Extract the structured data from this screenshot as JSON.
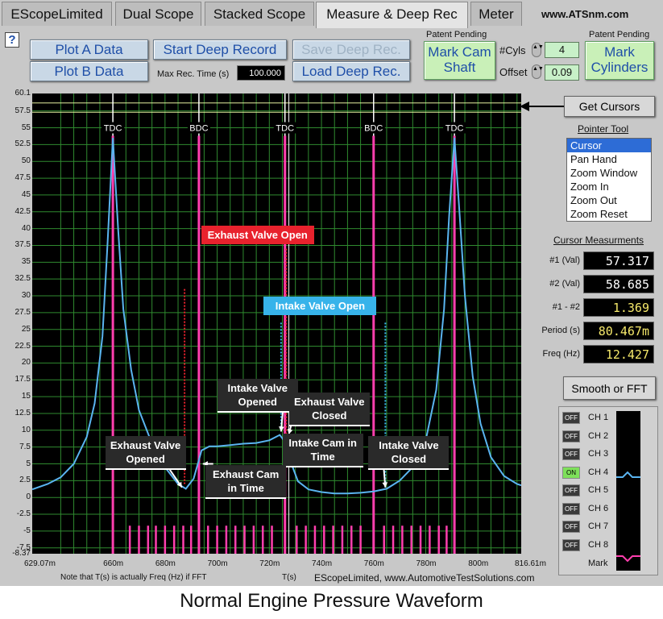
{
  "tabs": [
    {
      "label": "EScopeLimited",
      "active": false
    },
    {
      "label": "Dual Scope",
      "active": false
    },
    {
      "label": "Stacked Scope",
      "active": false
    },
    {
      "label": "Measure & Deep Rec",
      "active": true
    },
    {
      "label": "Meter",
      "active": false
    }
  ],
  "site": "www.ATSnm.com",
  "help": "?",
  "buttons": {
    "plot_a": "Plot A Data",
    "plot_b": "Plot B Data",
    "start_deep": "Start Deep Record",
    "save_deep": "Save Deep Rec.",
    "load_deep": "Load Deep Rec.",
    "mark_cam": "Mark Cam Shaft",
    "mark_cyl": "Mark Cylinders",
    "get_cursors": "Get Cursors",
    "smooth_fft": "Smooth or FFT"
  },
  "patent1": "Patent Pending",
  "patent2": "Patent Pending",
  "max_rec_label": "Max Rec. Time (s)",
  "max_rec_value": "100.000",
  "cyls_label": "#Cyls",
  "cyls_value": "4",
  "offset_label": "Offset",
  "offset_value": "0.09",
  "pointer": {
    "title": "Pointer Tool",
    "items": [
      "Cursor",
      "Pan Hand",
      "Zoom Window",
      "Zoom In",
      "Zoom Out",
      "Zoom Reset"
    ],
    "selected": 0
  },
  "cursor": {
    "title": "Cursor Measurments",
    "rows": [
      {
        "label": "#1 (Val)",
        "value": "57.317",
        "yellow": false
      },
      {
        "label": "#2 (Val)",
        "value": "58.685",
        "yellow": false
      },
      {
        "label": "#1 - #2",
        "value": "1.369",
        "yellow": true
      },
      {
        "label": "Period (s)",
        "value": "80.467m",
        "yellow": true
      },
      {
        "label": "Freq (Hz)",
        "value": "12.427",
        "yellow": true
      }
    ]
  },
  "channels": [
    {
      "label": "CH 1",
      "state": "OFF"
    },
    {
      "label": "CH 2",
      "state": "OFF"
    },
    {
      "label": "CH 3",
      "state": "OFF"
    },
    {
      "label": "CH 4",
      "state": "ON"
    },
    {
      "label": "CH 5",
      "state": "OFF"
    },
    {
      "label": "CH 6",
      "state": "OFF"
    },
    {
      "label": "CH 7",
      "state": "OFF"
    },
    {
      "label": "CH 8",
      "state": "OFF"
    }
  ],
  "mark_label": "Mark",
  "footer_note": "Note that T(s) is actually Freq (Hz) if FFT",
  "footer_ts": "T(s)",
  "footer_credit": "EScopeLimited, www.AutomotiveTestSolutions.com",
  "caption": "Normal Engine Pressure Waveform",
  "colors": {
    "trace": "#5ab4f0",
    "marker": "#ff3fae",
    "grid": "#2f8a2f",
    "exhaust_box": "#e8222d",
    "intake_box": "#37b3ea"
  },
  "chart_data": {
    "type": "line",
    "x_unit": "s",
    "xlim": [
      0.62907,
      0.81661
    ],
    "ylim": [
      -8.37,
      60.1
    ],
    "x_ticks": [
      "629.07m",
      "660m",
      "680m",
      "700m",
      "720m",
      "740m",
      "760m",
      "780m",
      "800m",
      "816.61m"
    ],
    "y_ticks": [
      "60.1",
      "57.5",
      "55",
      "52.5",
      "50",
      "47.5",
      "45",
      "42.5",
      "40",
      "37.5",
      "35",
      "32.5",
      "30",
      "27.5",
      "25",
      "22.5",
      "20",
      "17.5",
      "15",
      "12.5",
      "10",
      "7.5",
      "5",
      "2.5",
      "0",
      "-2.5",
      "-5",
      "-7.5",
      "-8.37"
    ],
    "markers": [
      {
        "label": "TDC",
        "x": 0.66
      },
      {
        "label": "BDC",
        "x": 0.693
      },
      {
        "label": "TDC",
        "x": 0.726
      },
      {
        "label": "BDC",
        "x": 0.76
      },
      {
        "label": "TDC",
        "x": 0.791
      }
    ],
    "annotations": [
      {
        "text": "Exhaust Valve Open",
        "style": "red",
        "x": 0.7155,
        "y": 39
      },
      {
        "text": "Intake Valve Open",
        "style": "blue",
        "x": 0.7395,
        "y": 28.5
      },
      {
        "text": "Intake Valve Opened",
        "style": "dark",
        "x": 0.7155,
        "y": 15.4
      },
      {
        "text": "Exhaust Valve Closed",
        "style": "dark",
        "x": 0.743,
        "y": 13.3
      },
      {
        "text": "Intake Cam in Time",
        "style": "dark",
        "x": 0.7405,
        "y": 7.2
      },
      {
        "text": "Exhaust Valve Opened",
        "style": "dark",
        "x": 0.6725,
        "y": 6.9
      },
      {
        "text": "Exhaust Cam in Time",
        "style": "dark",
        "x": 0.711,
        "y": 2.5
      },
      {
        "text": "Intake Valve Closed",
        "style": "dark",
        "x": 0.7735,
        "y": 6.9
      }
    ],
    "series": [
      {
        "values": [
          [
            0.6291,
            1.2
          ],
          [
            0.635,
            2.0
          ],
          [
            0.64,
            3.0
          ],
          [
            0.645,
            5.0
          ],
          [
            0.65,
            9.0
          ],
          [
            0.653,
            14.0
          ],
          [
            0.656,
            24.0
          ],
          [
            0.658,
            38.0
          ],
          [
            0.66,
            53.5
          ],
          [
            0.662,
            40.0
          ],
          [
            0.664,
            28.0
          ],
          [
            0.667,
            19.0
          ],
          [
            0.67,
            13.0
          ],
          [
            0.675,
            8.0
          ],
          [
            0.68,
            4.5
          ],
          [
            0.685,
            2.0
          ],
          [
            0.688,
            1.3
          ],
          [
            0.691,
            2.8
          ],
          [
            0.694,
            7.0
          ],
          [
            0.697,
            7.6
          ],
          [
            0.7,
            7.6
          ],
          [
            0.705,
            7.8
          ],
          [
            0.71,
            8.0
          ],
          [
            0.715,
            8.1
          ],
          [
            0.72,
            8.5
          ],
          [
            0.724,
            9.3
          ],
          [
            0.726,
            8.3
          ],
          [
            0.728,
            5.5
          ],
          [
            0.731,
            2.4
          ],
          [
            0.735,
            1.2
          ],
          [
            0.74,
            0.8
          ],
          [
            0.745,
            0.6
          ],
          [
            0.75,
            0.6
          ],
          [
            0.755,
            0.7
          ],
          [
            0.76,
            0.9
          ],
          [
            0.765,
            1.3
          ],
          [
            0.77,
            2.5
          ],
          [
            0.775,
            4.5
          ],
          [
            0.78,
            8.5
          ],
          [
            0.784,
            16.0
          ],
          [
            0.787,
            28.0
          ],
          [
            0.789,
            42.0
          ],
          [
            0.791,
            53.5
          ],
          [
            0.793,
            42.0
          ],
          [
            0.795,
            30.0
          ],
          [
            0.798,
            18.0
          ],
          [
            0.801,
            11.0
          ],
          [
            0.805,
            6.0
          ],
          [
            0.81,
            3.2
          ],
          [
            0.815,
            2.0
          ],
          [
            0.8166,
            1.8
          ]
        ]
      }
    ],
    "ticks_x": [
      0.6665,
      0.67,
      0.6735,
      0.6765,
      0.68,
      0.6835,
      0.687,
      0.69,
      0.6965,
      0.7,
      0.7035,
      0.707,
      0.7105,
      0.714,
      0.7175,
      0.721,
      0.7305,
      0.734,
      0.7375,
      0.741,
      0.7445,
      0.748,
      0.7515,
      0.755,
      0.764,
      0.7675,
      0.771,
      0.7745,
      0.778,
      0.7815,
      0.785,
      0.788
    ]
  }
}
